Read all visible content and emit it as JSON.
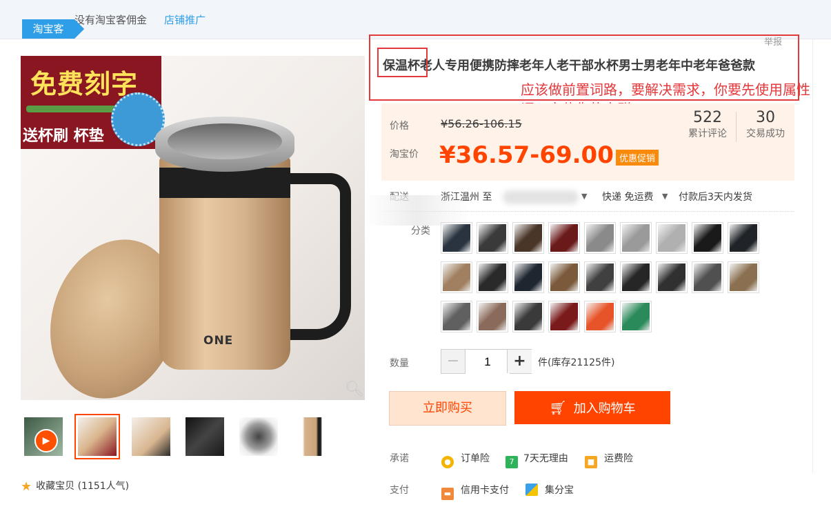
{
  "topbar": {
    "badge": "淘宝客",
    "no_commission": "没有淘宝客佣金",
    "shop_promo": "店铺推广",
    "report": "举报"
  },
  "gallery": {
    "promo_title": "免费刻字",
    "promo_sub": "送杯刷 杯垫",
    "cup_logo": "ONE",
    "thumbnails": [
      "video",
      "gold-cup",
      "gold-cup-side",
      "black-cup",
      "cup-top",
      "gold-cup-front"
    ],
    "active_thumbnail": 1
  },
  "favorite": {
    "label": "收藏宝贝 (1151人气)"
  },
  "product": {
    "title": "保温杯老人专用便携防摔老年人老干部水杯男士男老年中老年爸爸款",
    "annotation": "应该做前置词路，要解决需求，你要先使用属性词，定位你的人群"
  },
  "price": {
    "price_label": "价格",
    "original": "¥56.26-106.15",
    "taobao_label": "淘宝价",
    "promo": "¥36.57-69.00",
    "promo_tag": "优惠促销",
    "reviews_count": "522",
    "reviews_label": "累计评论",
    "deals_count": "30",
    "deals_label": "交易成功"
  },
  "shipping": {
    "label": "配送",
    "from": "浙江温州 至",
    "method": "快递 免运费",
    "dispatch": "付款后3天内发货"
  },
  "category": {
    "label": "分类",
    "sku_colors": [
      "#2a3440",
      "#3a3a3a",
      "#4a3628",
      "#6b1a1a",
      "#8a8a8a",
      "#9a9a9a",
      "#b0b0b0",
      "#1a1a1a",
      "#202428",
      "#a08060",
      "#2a2a2a",
      "#1e2630",
      "#7a5a3a",
      "#404040",
      "#262626",
      "#303030",
      "#505050",
      "#8a7050",
      "#606060",
      "#8a6a5a",
      "#3a3a3a",
      "#7a1a1a",
      "#e8542a",
      "#2a8a5a"
    ]
  },
  "quantity": {
    "label": "数量",
    "value": "1",
    "minus": "−",
    "plus": "+",
    "stock": "件(库存21125件)"
  },
  "actions": {
    "buy_now": "立即购买",
    "add_to_cart": "加入购物车"
  },
  "promise": {
    "label": "承诺",
    "items": [
      "订单险",
      "7天无理由",
      "运费险"
    ]
  },
  "payment": {
    "label": "支付",
    "items": [
      "信用卡支付",
      "集分宝"
    ]
  },
  "colors": {
    "accent": "#ff4400",
    "brand_blue": "#2f9ee8",
    "annotation_red": "#e4393c"
  }
}
